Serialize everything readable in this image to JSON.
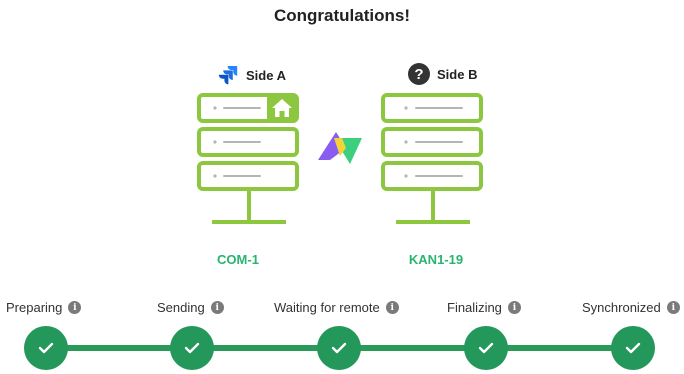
{
  "title": "Congratulations!",
  "side_a": {
    "label": "Side A",
    "logo_icon": "jira-logo-icon",
    "instance": "COM-1"
  },
  "side_b": {
    "label": "Side B",
    "logo_icon": "question-mark-icon",
    "logo_glyph": "?",
    "instance": "KAN1-19"
  },
  "sync_icon": "exalate-sync-logo-icon",
  "steps": [
    {
      "label": "Preparing",
      "status": "done"
    },
    {
      "label": "Sending",
      "status": "done"
    },
    {
      "label": "Waiting for remote",
      "status": "done"
    },
    {
      "label": "Finalizing",
      "status": "done"
    },
    {
      "label": "Synchronized",
      "status": "done"
    }
  ],
  "info_glyph": "i",
  "colors": {
    "server_green": "#8dc63f",
    "accent_green": "#27b46e",
    "step_green": "#23985a"
  }
}
